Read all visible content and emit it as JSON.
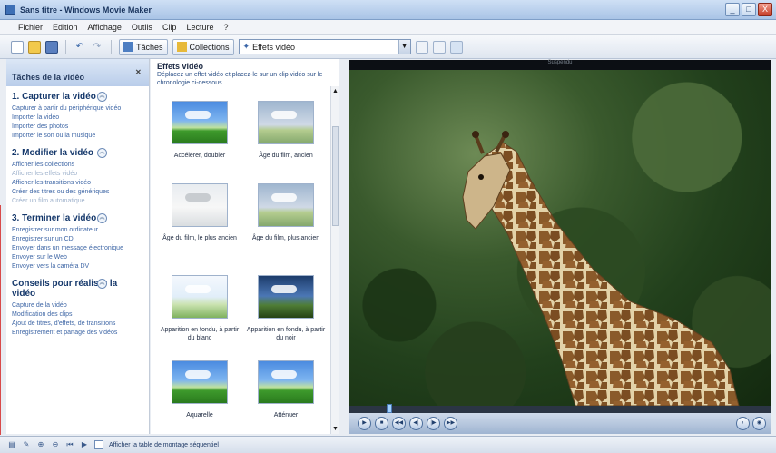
{
  "window": {
    "title": "Sans titre - Windows Movie Maker"
  },
  "window_buttons": [
    "_",
    "□",
    "X"
  ],
  "menu": [
    "Fichier",
    "Edition",
    "Affichage",
    "Outils",
    "Clip",
    "Lecture",
    "?"
  ],
  "toolbar": {
    "undo": "↶",
    "redo": "↷",
    "tasks_label": "Tâches",
    "collections_label": "Collections",
    "location_value": "Effets vidéo"
  },
  "taskpane": {
    "header": "Tâches de la vidéo",
    "sections": [
      {
        "title": "1. Capturer la vidéo",
        "links": [
          "Capturer à partir du périphérique vidéo",
          "Importer la vidéo",
          "Importer des photos",
          "Importer le son ou la musique"
        ]
      },
      {
        "title": "2. Modifier la vidéo",
        "links": [
          "Afficher les collections",
          "Afficher les effets vidéo",
          "Afficher les transitions vidéo",
          "Créer des titres ou des génériques",
          "Créer un film automatique"
        ]
      },
      {
        "title": "3. Terminer la vidéo",
        "links": [
          "Enregistrer sur mon ordinateur",
          "Enregistrer sur un CD",
          "Envoyer dans un message électronique",
          "Envoyer sur le Web",
          "Envoyer vers la caméra DV"
        ]
      },
      {
        "title": "Conseils pour réaliser la vidéo",
        "links": [
          "Capture de la vidéo",
          "Modification des clips",
          "Ajout de titres, d'effets, de transitions",
          "Enregistrement et partage des vidéos"
        ]
      }
    ]
  },
  "effects": {
    "title": "Effets vidéo",
    "description": "Déplacez un effet vidéo et placez-le sur un clip vidéo sur le chronologie ci-dessous.",
    "items": [
      {
        "label": "Accélérer, doubler",
        "style": "normal"
      },
      {
        "label": "Âge du film, ancien",
        "style": "faded"
      },
      {
        "label": "Âge du film, le plus ancien",
        "style": "sketch"
      },
      {
        "label": "Âge du film, plus ancien",
        "style": "faded"
      },
      {
        "label": "Apparition en fondu, à partir du blanc",
        "style": "white"
      },
      {
        "label": "Apparition en fondu, à partir du noir",
        "style": "dark"
      },
      {
        "label": "Aquarelle",
        "style": "normal"
      },
      {
        "label": "Atténuer",
        "style": "normal"
      }
    ]
  },
  "preview": {
    "status": "Suspendu"
  },
  "storyboard": {
    "label": "Afficher la table de montage séquentiel"
  },
  "icons": {
    "new": "new-project-icon",
    "open": "open-icon",
    "save": "save-icon",
    "play": "play-icon",
    "stop": "stop-icon",
    "prev": "previous-frame-icon",
    "next": "next-frame-icon",
    "split": "split-clip-icon",
    "snapshot": "snapshot-icon",
    "fullscreen": "fullscreen-icon"
  }
}
